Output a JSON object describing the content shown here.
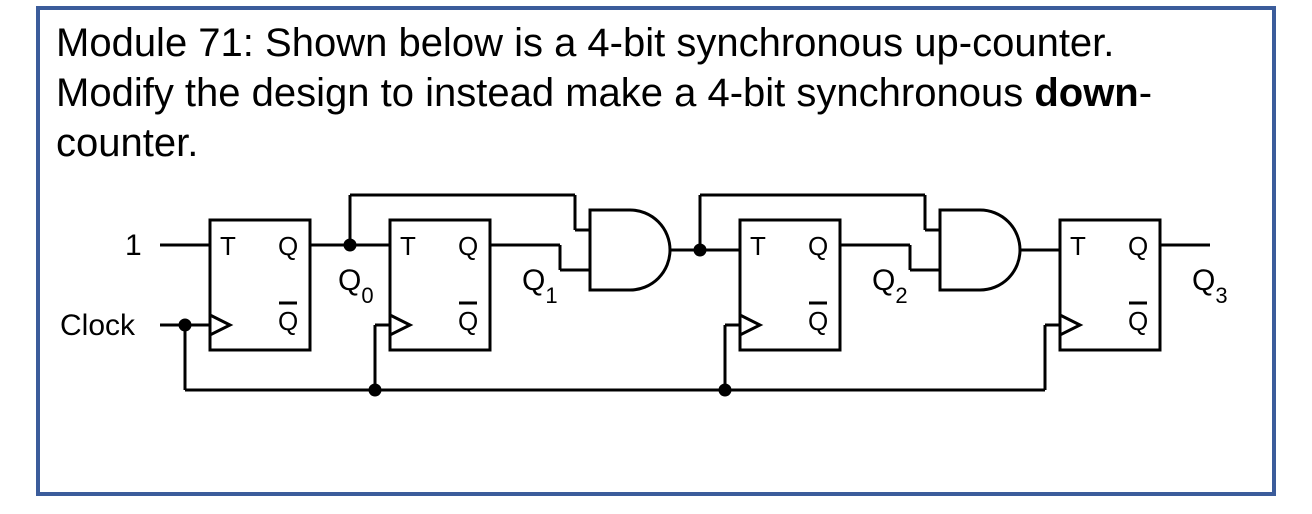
{
  "prompt": {
    "line1": "Module 71: Shown below is a 4-bit synchronous up-counter.",
    "line2_a": "Modify the design to instead make a 4-bit synchronous ",
    "line2_b": "down",
    "line2_c": "-",
    "line3": "counter."
  },
  "inputs": {
    "constant": "1",
    "clock": "Clock"
  },
  "flipflops": [
    {
      "output": "Q",
      "output_sub": "0",
      "T": "T",
      "Q": "Q",
      "Qbar": "Q"
    },
    {
      "output": "Q",
      "output_sub": "1",
      "T": "T",
      "Q": "Q",
      "Qbar": "Q"
    },
    {
      "output": "Q",
      "output_sub": "2",
      "T": "T",
      "Q": "Q",
      "Qbar": "Q"
    },
    {
      "output": "Q",
      "output_sub": "3",
      "T": "T",
      "Q": "Q",
      "Qbar": "Q"
    }
  ],
  "chart_data": {
    "type": "logic-diagram",
    "description": "4-bit synchronous up-counter using T flip-flops with AND gates between stages",
    "flip_flop_count": 4,
    "flip_flop_type": "T",
    "t0_input": "1",
    "t1_input": "Q0",
    "t2_input": "Q0 AND Q1",
    "t3_input": "(Q0 AND Q1) AND Q2",
    "common_clock": true,
    "outputs": [
      "Q0",
      "Q1",
      "Q2",
      "Q3"
    ],
    "gates": [
      "AND",
      "AND"
    ]
  }
}
